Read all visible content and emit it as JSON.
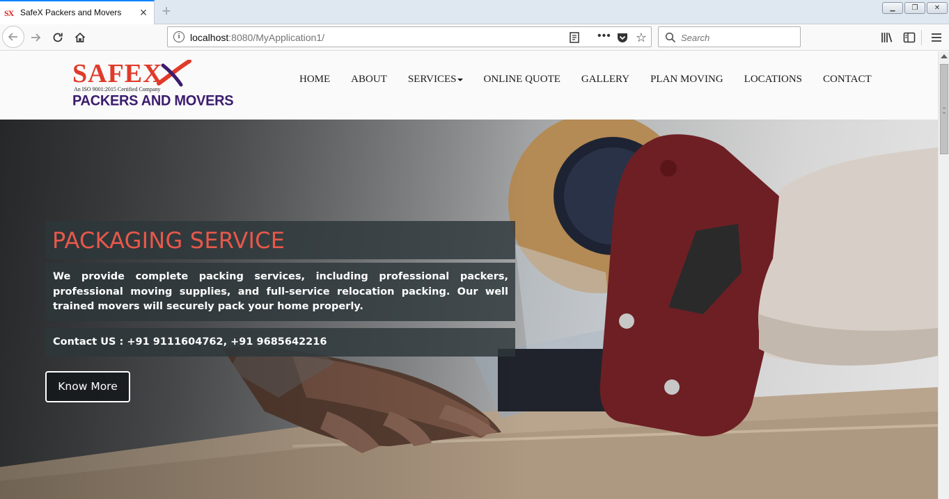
{
  "browser": {
    "tab_title": "SafeX Packers and Movers",
    "tab_favicon_text": "SX",
    "new_tab_icon": "plus-icon",
    "url_host": "localhost",
    "url_rest": ":8080/MyApplication1/",
    "search_placeholder": "Search",
    "accent_color": "#0a84ff"
  },
  "site": {
    "logo": {
      "name": "SAFEX",
      "tagline": "An ISO 9001:2015 Certified Company",
      "subtitle": "PACKERS AND MOVERS",
      "colors": {
        "primary": "#e03a2a",
        "secondary": "#3b1c6e"
      }
    },
    "nav": {
      "home": "HOME",
      "about": "ABOUT",
      "services": "SERVICES",
      "quote": "ONLINE QUOTE",
      "gallery": "GALLERY",
      "plan": "PLAN MOVING",
      "locations": "LOCATIONS",
      "contact": "CONTACT"
    }
  },
  "hero": {
    "title": "PACKAGING SERVICE",
    "description": "We provide complete packing services, including professional packers, professional moving supplies, and full-service relocation packing. Our well trained movers will securely pack your home properly.",
    "contact": "Contact US : +91 9111604762, +91 9685642216",
    "cta": "Know More",
    "title_color": "#e8584a"
  }
}
